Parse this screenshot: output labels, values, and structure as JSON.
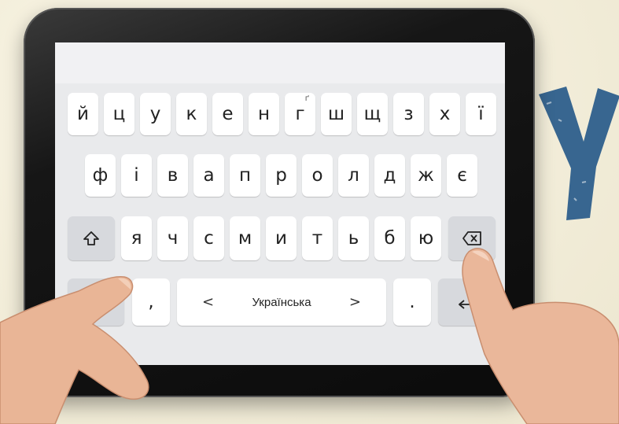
{
  "keyboard": {
    "row1": [
      "й",
      "ц",
      "у",
      "к",
      "е",
      "н",
      "г",
      "ш",
      "щ",
      "з",
      "х",
      "ї"
    ],
    "row1_hint": "ґ",
    "row2": [
      "ф",
      "і",
      "в",
      "а",
      "п",
      "р",
      "о",
      "л",
      "д",
      "ж",
      "є"
    ],
    "row3": [
      "я",
      "ч",
      "с",
      "м",
      "и",
      "т",
      "ь",
      "б",
      "ю"
    ],
    "comma": ",",
    "period": ".",
    "space_label": "Українська",
    "space_left_arrow": "<",
    "space_right_arrow": ">"
  },
  "icons": {
    "shift": "shift-icon",
    "backspace": "backspace-icon",
    "enter": "enter-icon",
    "symbols": "symbols-key"
  },
  "colors": {
    "key": "#ffffff",
    "func_key": "#d7d9dd",
    "keyboard_bg": "#e9eaec",
    "bezel": "#111111",
    "letter_blue": "#2d5f8c"
  }
}
